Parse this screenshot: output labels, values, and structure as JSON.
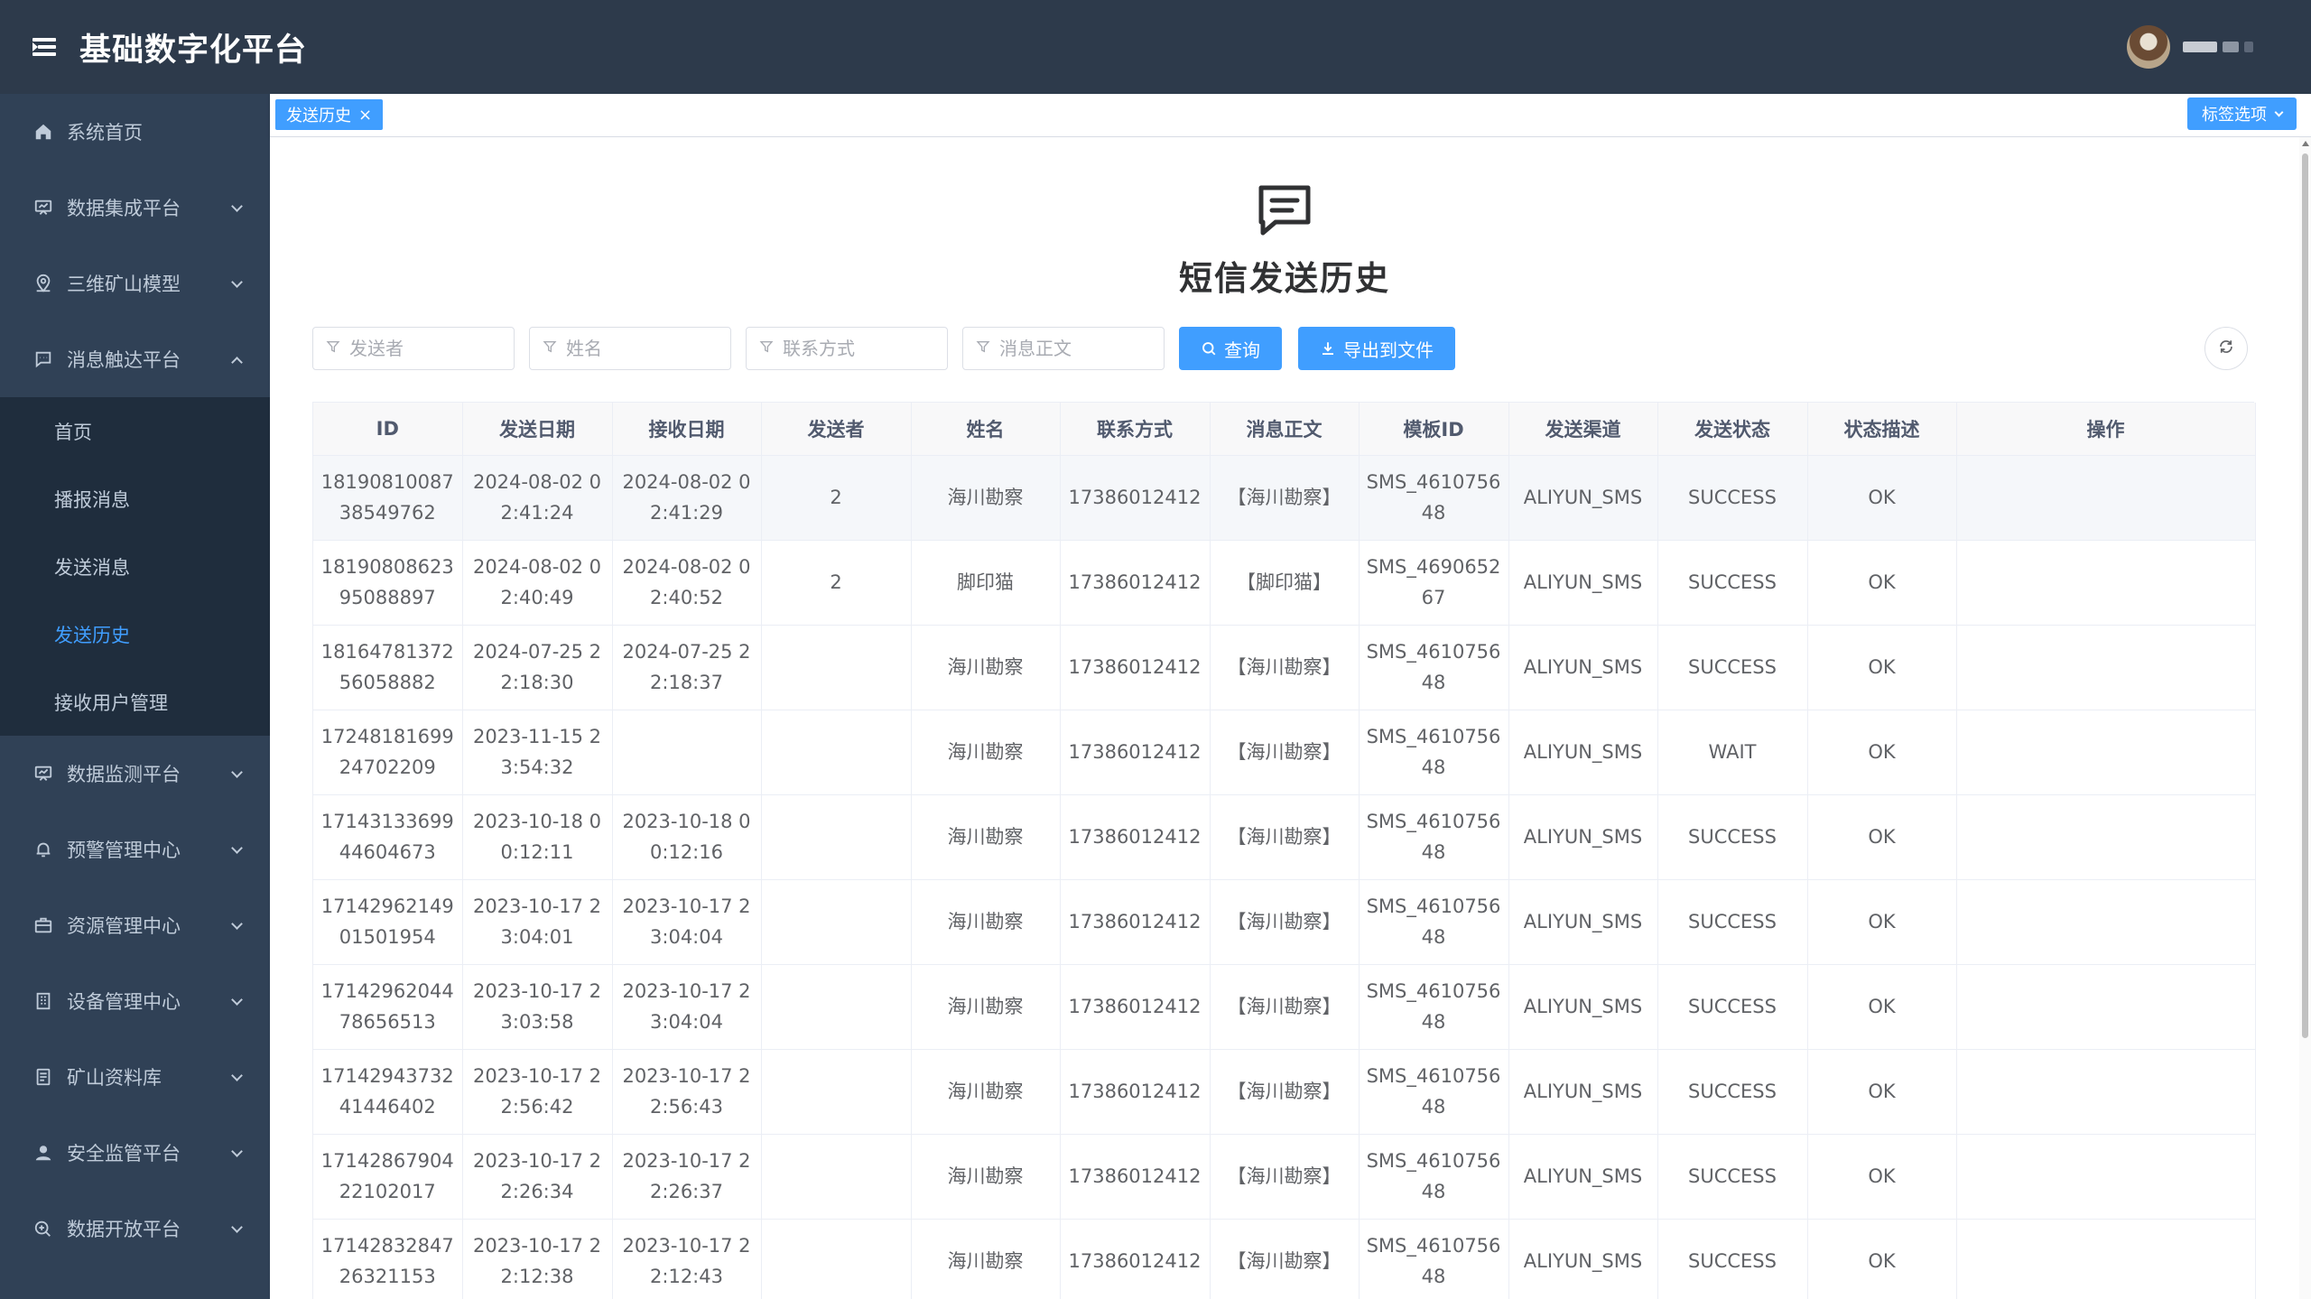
{
  "header": {
    "title": "基础数字化平台"
  },
  "sidebar": {
    "items": [
      {
        "label": "系统首页",
        "icon": "home-icon"
      },
      {
        "label": "数据集成平台",
        "icon": "monitor-icon"
      },
      {
        "label": "三维矿山模型",
        "icon": "map-pin-icon"
      },
      {
        "label": "消息触达平台",
        "icon": "message-icon",
        "expanded": true
      },
      {
        "label": "数据监测平台",
        "icon": "monitor-icon"
      },
      {
        "label": "预警管理中心",
        "icon": "bell-icon"
      },
      {
        "label": "资源管理中心",
        "icon": "briefcase-icon"
      },
      {
        "label": "设备管理中心",
        "icon": "building-icon"
      },
      {
        "label": "矿山资料库",
        "icon": "document-icon"
      },
      {
        "label": "安全监管平台",
        "icon": "user-icon"
      },
      {
        "label": "数据开放平台",
        "icon": "share-icon"
      }
    ],
    "subitems": [
      {
        "label": "首页"
      },
      {
        "label": "播报消息"
      },
      {
        "label": "发送消息"
      },
      {
        "label": "发送历史",
        "active": true
      },
      {
        "label": "接收用户管理"
      }
    ]
  },
  "tabs": {
    "active_label": "发送历史",
    "options_label": "标签选项"
  },
  "page": {
    "title": "短信发送历史"
  },
  "filters": {
    "sender_placeholder": "发送者",
    "name_placeholder": "姓名",
    "contact_placeholder": "联系方式",
    "message_placeholder": "消息正文",
    "query_label": "查询",
    "export_label": "导出到文件"
  },
  "table": {
    "columns": [
      "ID",
      "发送日期",
      "接收日期",
      "发送者",
      "姓名",
      "联系方式",
      "消息正文",
      "模板ID",
      "发送渠道",
      "发送状态",
      "状态描述",
      "操作"
    ],
    "rows": [
      [
        "1819081008738549762",
        "2024-08-02 02:41:24",
        "2024-08-02 02:41:29",
        "2",
        "海川勘察",
        "17386012412",
        "【海川勘察】",
        "SMS_461075648",
        "ALIYUN_SMS",
        "SUCCESS",
        "OK",
        ""
      ],
      [
        "1819080862395088897",
        "2024-08-02 02:40:49",
        "2024-08-02 02:40:52",
        "2",
        "脚印猫",
        "17386012412",
        "【脚印猫】",
        "SMS_469065267",
        "ALIYUN_SMS",
        "SUCCESS",
        "OK",
        ""
      ],
      [
        "1816478137256058882",
        "2024-07-25 22:18:30",
        "2024-07-25 22:18:37",
        "",
        "海川勘察",
        "17386012412",
        "【海川勘察】",
        "SMS_461075648",
        "ALIYUN_SMS",
        "SUCCESS",
        "OK",
        ""
      ],
      [
        "1724818169924702209",
        "2023-11-15 23:54:32",
        "",
        "",
        "海川勘察",
        "17386012412",
        "【海川勘察】",
        "SMS_461075648",
        "ALIYUN_SMS",
        "WAIT",
        "OK",
        ""
      ],
      [
        "1714313369944604673",
        "2023-10-18 00:12:11",
        "2023-10-18 00:12:16",
        "",
        "海川勘察",
        "17386012412",
        "【海川勘察】",
        "SMS_461075648",
        "ALIYUN_SMS",
        "SUCCESS",
        "OK",
        ""
      ],
      [
        "1714296214901501954",
        "2023-10-17 23:04:01",
        "2023-10-17 23:04:04",
        "",
        "海川勘察",
        "17386012412",
        "【海川勘察】",
        "SMS_461075648",
        "ALIYUN_SMS",
        "SUCCESS",
        "OK",
        ""
      ],
      [
        "1714296204478656513",
        "2023-10-17 23:03:58",
        "2023-10-17 23:04:04",
        "",
        "海川勘察",
        "17386012412",
        "【海川勘察】",
        "SMS_461075648",
        "ALIYUN_SMS",
        "SUCCESS",
        "OK",
        ""
      ],
      [
        "1714294373241446402",
        "2023-10-17 22:56:42",
        "2023-10-17 22:56:43",
        "",
        "海川勘察",
        "17386012412",
        "【海川勘察】",
        "SMS_461075648",
        "ALIYUN_SMS",
        "SUCCESS",
        "OK",
        ""
      ],
      [
        "1714286790422102017",
        "2023-10-17 22:26:34",
        "2023-10-17 22:26:37",
        "",
        "海川勘察",
        "17386012412",
        "【海川勘察】",
        "SMS_461075648",
        "ALIYUN_SMS",
        "SUCCESS",
        "OK",
        ""
      ],
      [
        "1714283284726321153",
        "2023-10-17 22:12:38",
        "2023-10-17 22:12:43",
        "",
        "海川勘察",
        "17386012412",
        "【海川勘察】",
        "SMS_461075648",
        "ALIYUN_SMS",
        "SUCCESS",
        "OK",
        ""
      ]
    ]
  },
  "colors": {
    "header_bg": "#2d3a4b",
    "sidebar_bg": "#304156",
    "submenu_bg": "#1f2d3d",
    "accent": "#409eff"
  }
}
